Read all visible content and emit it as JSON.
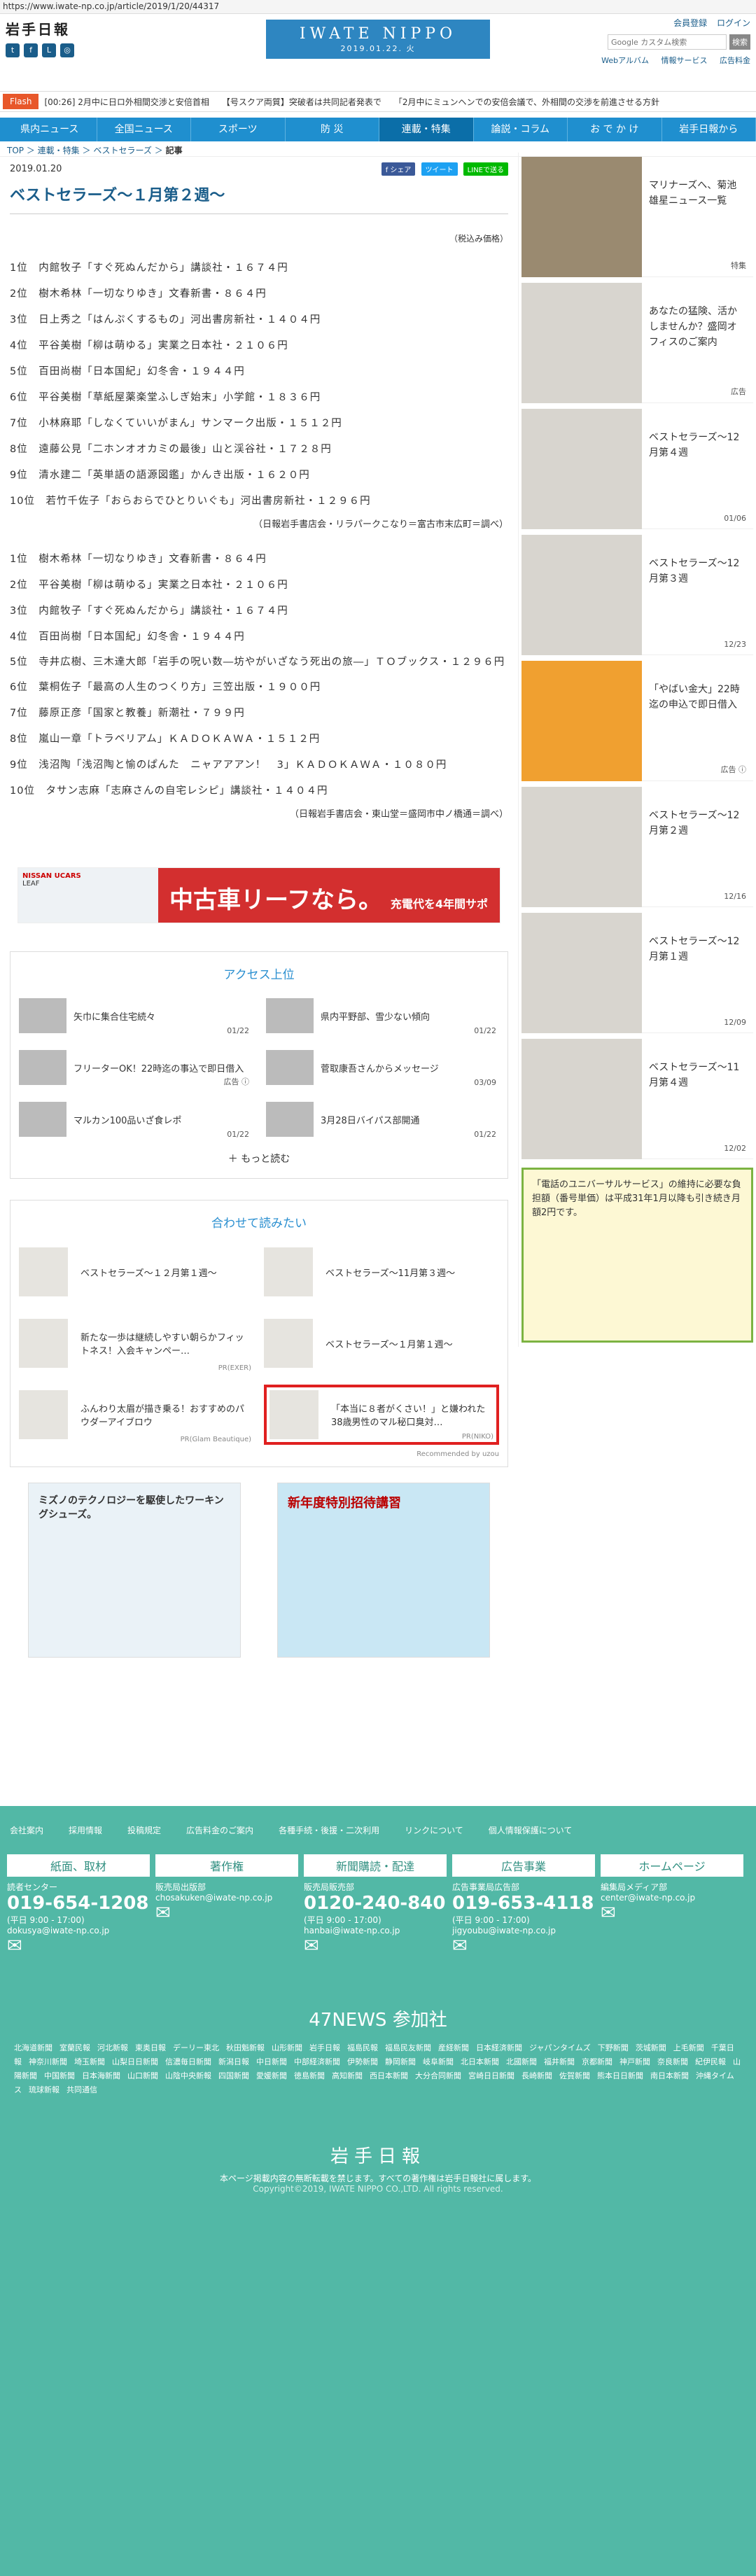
{
  "url": "https://www.iwate-np.co.jp/article/2019/1/20/44317",
  "header": {
    "logo": "岩手日報",
    "title": "IWATE NIPPO",
    "date": "2019.01.22. 火",
    "links": [
      "会員登録",
      "ログイン"
    ],
    "search_placeholder": "Google カスタム検索",
    "search_button": "検索",
    "subnav": [
      "Webアルバム",
      "情報サービス",
      "広告料金"
    ]
  },
  "flash": {
    "label": "Flash",
    "items": [
      "[00:26] 2月中に日ロ外相間交渉と安倍首相",
      "【号スクア両質】突破者は共同記者発表で",
      "「2月中にミュンヘンでの安倍会議で、外相間の交渉を前進させる方針"
    ]
  },
  "nav": [
    "県内ニュース",
    "全国ニュース",
    "スポーツ",
    "防 災",
    "連載・特集",
    "論説・コラム",
    "お で か け",
    "岩手日報から"
  ],
  "breadcrumb": [
    "TOP",
    "連載・特集",
    "ベストセラーズ",
    "記事"
  ],
  "article": {
    "date": "2019.01.20",
    "share": [
      "f シェア",
      "ツイート",
      "LINEで送る"
    ],
    "title": "ベストセラーズ～１月第２週～",
    "note": "（税込み価格）",
    "list1": [
      "1位　内館牧子「すぐ死ぬんだから」講談社・１６７４円",
      "2位　樹木希林「一切なりゆき」文春新書・８６４円",
      "3位　日上秀之「はんぷくするもの」河出書房新社・１４０４円",
      "4位　平谷美樹「柳は萌ゆる」実業之日本社・２１０６円",
      "5位　百田尚樹「日本国紀」幻冬舎・１９４４円",
      "6位　平谷美樹「草紙屋薬楽堂ふしぎ始末」小学館・１８３６円",
      "7位　小林麻耶「しなくていいがまん」サンマーク出版・１５１２円",
      "8位　遠藤公見「二ホンオオカミの最後」山と渓谷社・１７２８円",
      "9位　清水建二「英単語の語源図鑑」かんき出版・１６２０円",
      "10位　若竹千佐子「おらおらでひとりいぐも」河出書房新社・１２９６円"
    ],
    "src1": "（日報岩手書店会・リラパークこなり＝富古市末広町＝調べ）",
    "list2a": [
      "1位　樹木希林「一切なりゆき」文春新書・８６４円",
      "2位　平谷美樹「柳は萌ゆる」実業之日本社・２１０６円",
      "3位　内館牧子「すぐ死ぬんだから」講談社・１６７４円",
      "4位　百田尚樹「日本国紀」幻冬舎・１９４４円"
    ],
    "list2wrap": "5位　寺井広樹、三木達大郎「岩手の呪い数―坊やがいざなう死出の旅―」ＴＯブックス・１２９６円",
    "list2b": [
      "6位　葉桐佐子「最高の人生のつくり方」三笠出版・１９００円",
      "7位　藤原正彦「国家と教養」新潮社・７９９円",
      "8位　嵐山一章「トラベリアム」ＫＡＤＯＫＡＷＡ・１５１２円",
      "9位　浅沼陶「浅沼陶と愉のぱんた　ニャアアアン！　3」ＫＡＤＯＫＡＷＡ・１０８０円",
      "10位　タサン志麻「志麻さんの自宅レシピ」講談社・１４０４円"
    ],
    "src2": "（日報岩手書店会・東山堂＝盛岡市中ノ橋通＝調べ）"
  },
  "ad_leaf": {
    "brand": "NISSAN UCARS",
    "sub": "LEAF",
    "copy": "中古車リーフなら。",
    "tag": "充電代を4年間サポート!"
  },
  "access": {
    "title": "アクセス上位",
    "items": [
      {
        "text": "矢巾に集合住宅続々",
        "date": "01/22"
      },
      {
        "text": "県内平野部、雪少ない傾向",
        "date": "01/22"
      },
      {
        "text": "フリーターOK！22時迄の事込で即日借入",
        "date": "広告 ⓘ"
      },
      {
        "text": "菅取康吾さんからメッセージ",
        "date": "03/09"
      },
      {
        "text": "マルカン100品いざ食レポ",
        "date": "01/22"
      },
      {
        "text": "3月28日バイパス部開通",
        "date": "01/22"
      }
    ],
    "more": "もっと読む"
  },
  "related": {
    "title": "合わせて読みたい",
    "items": [
      {
        "text": "ベストセラーズ～１２月第１週～",
        "pr": ""
      },
      {
        "text": "ベストセラーズ～11月第３週～",
        "pr": ""
      },
      {
        "text": "新たな一歩は継続しやすい朝らかフィットネス！入会キャンペー…",
        "pr": "PR(EXER)"
      },
      {
        "text": "ベストセラーズ～１月第１週～",
        "pr": ""
      },
      {
        "text": "ふんわり太眉が描き乗る！おすすめのパウダーアイブロウ",
        "pr": "PR(Glam Beautique)"
      },
      {
        "text": "「本当に８者がくさい！」と嫌われた38歳男性のマル秘口臭対…",
        "pr": "PR(NIKO)"
      }
    ],
    "rec": "Recommended by uzou"
  },
  "ads2": [
    "ミズノのテクノロジーを駆使したワーキングシューズ。",
    "新年度特別招待講習"
  ],
  "side": [
    {
      "text": "マリナーズへ、菊池雄星ニュース一覧",
      "date": "特集"
    },
    {
      "text": "あなたの猛険、活かしませんか？盛岡オフィスのご案内",
      "date": "広告"
    },
    {
      "text": "ベストセラーズ～12月第４週",
      "date": "01/06"
    },
    {
      "text": "ベストセラーズ～12月第３週",
      "date": "12/23"
    },
    {
      "text": "「やばい金大」22時迄の申込で即日借入",
      "date": "広告 ⓘ"
    },
    {
      "text": "ベストセラーズ～12月第２週",
      "date": "12/16"
    },
    {
      "text": "ベストセラーズ～12月第１週",
      "date": "12/09"
    },
    {
      "text": "ベストセラーズ～11月第４週",
      "date": "12/02"
    }
  ],
  "side_ad": "「電話のユニバーサルサービス」の維持に必要な負担額（番号単価）は平成31年1月以降も引き続き月額2円です。",
  "footer": {
    "links": [
      "会社案内",
      "採用情報",
      "投稿規定",
      "広告料金のご案内",
      "各種手続・後援・二次利用",
      "リンクについて",
      "個人情報保護について"
    ],
    "cols": [
      {
        "h": "紙面、取材",
        "l": "読者センター",
        "tel": "019-654-1208",
        "hours": "(平日 9:00 - 17:00)",
        "mail": "dokusya@iwate-np.co.jp"
      },
      {
        "h": "著作権",
        "l": "販売局出版部",
        "tel": "",
        "hours": "",
        "mail": "chosakuken@iwate-np.co.jp"
      },
      {
        "h": "新聞購読・配達",
        "l": "販売局販売部",
        "tel": "0120-240-840",
        "hours": "(平日 9:00 - 17:00)",
        "mail": "hanbai@iwate-np.co.jp"
      },
      {
        "h": "広告事業",
        "l": "広告事業局広告部",
        "tel": "019-653-4118",
        "hours": "(平日 9:00 - 17:00)",
        "mail": "jigyoubu@iwate-np.co.jp"
      },
      {
        "h": "ホームページ",
        "l": "編集局メディア部",
        "tel": "",
        "hours": "",
        "mail": "center@iwate-np.co.jp"
      }
    ],
    "n47": "47NEWS 参加社",
    "members": [
      "北海道新聞",
      "室蘭民報",
      "河北新報",
      "東奥日報",
      "デーリー東北",
      "秋田魁新報",
      "山形新聞",
      "岩手日報",
      "福島民報",
      "福島民友新聞",
      "産経新聞",
      "日本経済新聞",
      "ジャパンタイムズ",
      "下野新聞",
      "茨城新聞",
      "上毛新聞",
      "千葉日報",
      "神奈川新聞",
      "埼玉新聞",
      "山梨日日新聞",
      "信濃毎日新聞",
      "新潟日報",
      "中日新聞",
      "中部経済新聞",
      "伊勢新聞",
      "静岡新聞",
      "岐阜新聞",
      "北日本新聞",
      "北國新聞",
      "福井新聞",
      "京都新聞",
      "神戸新聞",
      "奈良新聞",
      "紀伊民報",
      "山陽新聞",
      "中国新聞",
      "日本海新聞",
      "山口新聞",
      "山陰中央新報",
      "四国新聞",
      "愛媛新聞",
      "徳島新聞",
      "高知新聞",
      "西日本新聞",
      "大分合同新聞",
      "宮崎日日新聞",
      "長崎新聞",
      "佐賀新聞",
      "熊本日日新聞",
      "南日本新聞",
      "沖縄タイムス",
      "琉球新報",
      "共同通信"
    ],
    "logo": "岩手日報",
    "notice": "本ページ掲載内容の無断転載を禁じます。すべての著作権は岩手日報社に属します。",
    "copyright": "Copyright©2019, IWATE NIPPO CO.,LTD. All rights reserved."
  }
}
